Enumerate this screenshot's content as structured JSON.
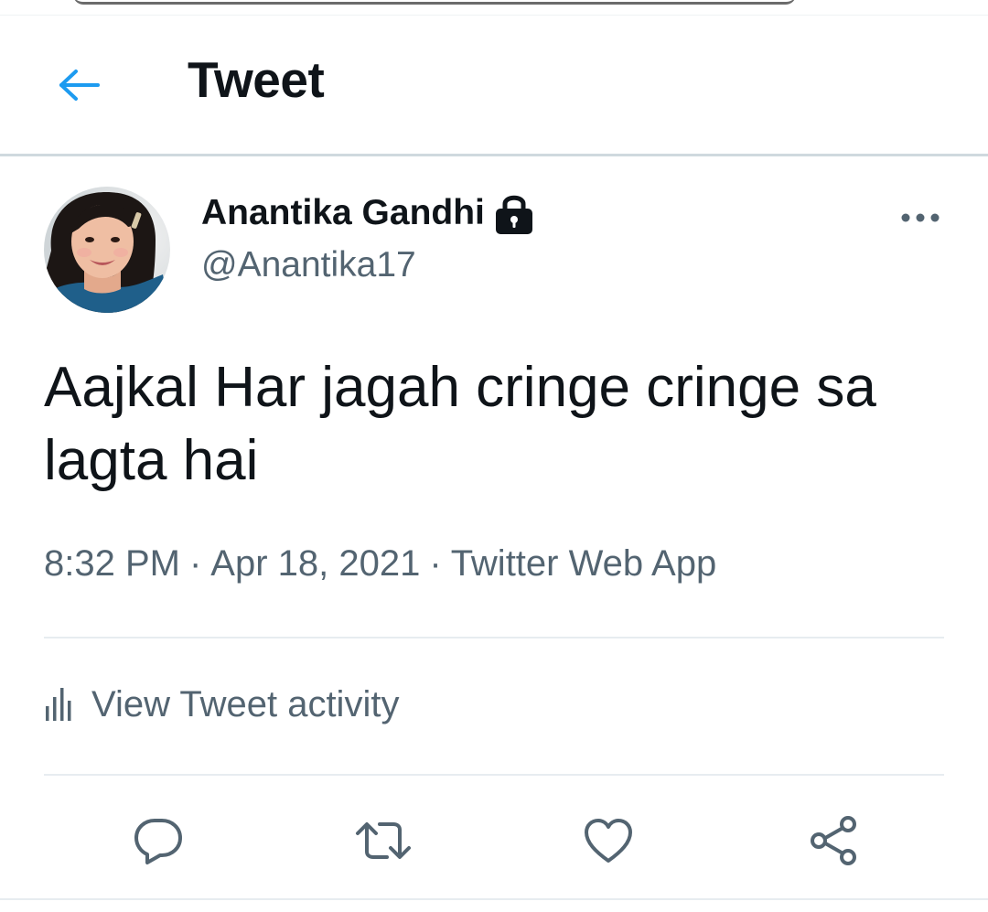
{
  "header": {
    "title": "Tweet",
    "back_icon": "arrow-left-icon"
  },
  "tweet": {
    "author": {
      "name": "Anantika Gandhi",
      "handle": "@Anantika17",
      "protected_icon": "lock-icon",
      "avatar": "avatar-photo"
    },
    "more_icon": "more-dots-icon",
    "text": "Aajkal Har jagah cringe cringe sa lagta hai",
    "time": "8:32 PM",
    "date": "Apr 18, 2021",
    "separator": "·",
    "source": "Twitter Web App"
  },
  "activity": {
    "label": "View Tweet activity",
    "icon": "analytics-bars-icon"
  },
  "actions": [
    {
      "name": "reply",
      "icon": "reply-bubble-icon"
    },
    {
      "name": "retweet",
      "icon": "retweet-icon"
    },
    {
      "name": "like",
      "icon": "heart-icon"
    },
    {
      "name": "share",
      "icon": "share-icon"
    }
  ],
  "colors": {
    "accent": "#1d9bf0",
    "text_primary": "#0f1419",
    "text_secondary": "#536471",
    "divider": "#e7ecf0"
  }
}
